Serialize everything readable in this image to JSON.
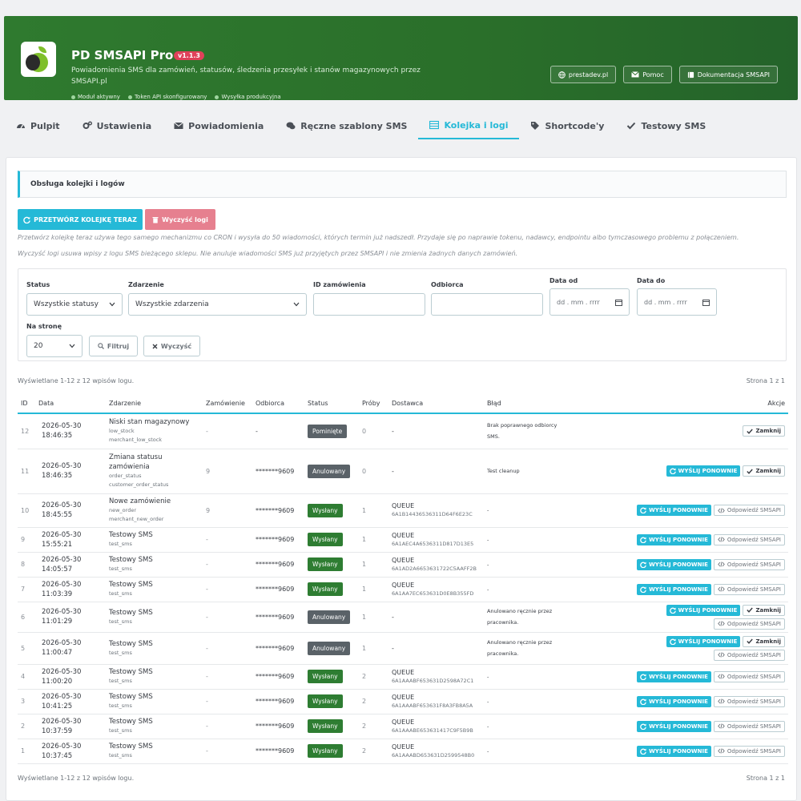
{
  "header": {
    "title": "PD SMSAPI Pro",
    "version": "v1.1.3",
    "description": "Powiadomienia SMS dla zamówień, statusów, śledzenia przesyłek i stanów magazynowych przez SMSAPI.pl",
    "status_pills": [
      "Moduł aktywny",
      "Token API skonfigurowany",
      "Wysyłka produkcyjna"
    ],
    "buttons": [
      "prestadev.pl",
      "Pomoc",
      "Dokumentacja SMSAPI"
    ]
  },
  "tabs": [
    "Pulpit",
    "Ustawienia",
    "Powiadomienia",
    "Ręczne szablony SMS",
    "Kolejka i logi",
    "Shortcode'y",
    "Testowy SMS"
  ],
  "active_tab": "Kolejka i logi",
  "section_title": "Obsługa kolejki i logów",
  "actions": {
    "process_queue": "PRZETWÓRZ KOLEJKĘ TERAZ",
    "clear_logs": "Wyczyść logi"
  },
  "help": [
    "Przetwórz kolejkę teraz używa tego samego mechanizmu co CRON i wysyła do 50 wiadomości, których termin już nadszedł. Przydaje się po naprawie tokenu, nadawcy, endpointu albo tymczasowego problemu z połączeniem.",
    "Wyczyść logi usuwa wpisy z logu SMS bieżącego sklepu. Nie anuluje wiadomości SMS już przyjętych przez SMSAPI i nie zmienia żadnych danych zamówień."
  ],
  "filters": {
    "status_label": "Status",
    "status_value": "Wszystkie statusy",
    "event_label": "Zdarzenie",
    "event_value": "Wszystkie zdarzenia",
    "order_id_label": "ID zamówienia",
    "recipient_label": "Odbiorca",
    "date_from_label": "Data od",
    "date_to_label": "Data do",
    "date_placeholder": "dd . mm . rrrr",
    "per_page_label": "Na stronę",
    "per_page_value": "20",
    "filter_btn": "Filtruj",
    "reset_btn": "Wyczyść"
  },
  "summary": "Wyświetlane 1-12 z 12 wpisów logu.",
  "page_info": "Strona 1 z 1",
  "columns": [
    "ID",
    "Data",
    "Zdarzenie",
    "Zamówienie",
    "Odbiorca",
    "Status",
    "Próby",
    "Dostawca",
    "Błąd",
    "Akcje"
  ],
  "action_labels": {
    "resend": "WYŚLIJ PONOWNIE",
    "close": "Zamknij",
    "reply": "Odpowiedź SMSAPI"
  },
  "rows": [
    {
      "id": "12",
      "date": "2026-05-30",
      "time": "18:46:35",
      "event": "Niski stan magazynowy",
      "codes": [
        "low_stock",
        "merchant_low_stock"
      ],
      "order": "-",
      "recipient": "-",
      "status": "Pominięte",
      "status_type": "skip",
      "tries": "0",
      "provider": "-",
      "provider_id": "",
      "error": "Brak poprawnego odbiorcy SMS.",
      "actions": [
        "close"
      ]
    },
    {
      "id": "11",
      "date": "2026-05-30",
      "time": "18:46:35",
      "event": "Zmiana statusu zamówienia",
      "codes": [
        "order_status",
        "customer_order_status"
      ],
      "order": "9",
      "recipient": "*******9609",
      "status": "Anulowany",
      "status_type": "cancel",
      "tries": "0",
      "provider": "-",
      "provider_id": "",
      "error": "Test cleanup",
      "actions": [
        "resend",
        "close"
      ]
    },
    {
      "id": "10",
      "date": "2026-05-30",
      "time": "18:45:55",
      "event": "Nowe zamówienie",
      "codes": [
        "new_order",
        "merchant_new_order"
      ],
      "order": "9",
      "recipient": "*******9609",
      "status": "Wysłany",
      "status_type": "sent",
      "tries": "1",
      "provider": "QUEUE",
      "provider_id": "6A1B14436536311D64F6E23C",
      "error": "-",
      "actions": [
        "resend",
        "reply"
      ]
    },
    {
      "id": "9",
      "date": "2026-05-30",
      "time": "15:55:21",
      "event": "Testowy SMS",
      "codes": [
        "test_sms"
      ],
      "order": "-",
      "recipient": "*******9609",
      "status": "Wysłany",
      "status_type": "sent",
      "tries": "1",
      "provider": "QUEUE",
      "provider_id": "6A1AEC4A6536311D817D13E5",
      "error": "-",
      "actions": [
        "resend",
        "reply"
      ]
    },
    {
      "id": "8",
      "date": "2026-05-30",
      "time": "14:05:57",
      "event": "Testowy SMS",
      "codes": [
        "test_sms"
      ],
      "order": "-",
      "recipient": "*******9609",
      "status": "Wysłany",
      "status_type": "sent",
      "tries": "1",
      "provider": "QUEUE",
      "provider_id": "6A1AD2A6653631722C5AAFF2B",
      "error": "-",
      "actions": [
        "resend",
        "reply"
      ]
    },
    {
      "id": "7",
      "date": "2026-05-30",
      "time": "11:03:39",
      "event": "Testowy SMS",
      "codes": [
        "test_sms"
      ],
      "order": "-",
      "recipient": "*******9609",
      "status": "Wysłany",
      "status_type": "sent",
      "tries": "1",
      "provider": "QUEUE",
      "provider_id": "6A1AA7EC653631D0E8B355FD",
      "error": "-",
      "actions": [
        "resend",
        "reply"
      ]
    },
    {
      "id": "6",
      "date": "2026-05-30",
      "time": "11:01:29",
      "event": "Testowy SMS",
      "codes": [
        "test_sms"
      ],
      "order": "-",
      "recipient": "*******9609",
      "status": "Anulowany",
      "status_type": "cancel",
      "tries": "1",
      "provider": "-",
      "provider_id": "",
      "error": "Anulowano ręcznie przez pracownika.",
      "actions": [
        "resend",
        "close",
        "reply"
      ]
    },
    {
      "id": "5",
      "date": "2026-05-30",
      "time": "11:00:47",
      "event": "Testowy SMS",
      "codes": [
        "test_sms"
      ],
      "order": "-",
      "recipient": "*******9609",
      "status": "Anulowany",
      "status_type": "cancel",
      "tries": "1",
      "provider": "-",
      "provider_id": "",
      "error": "Anulowano ręcznie przez pracownika.",
      "actions": [
        "resend",
        "close",
        "reply"
      ]
    },
    {
      "id": "4",
      "date": "2026-05-30",
      "time": "11:00:20",
      "event": "Testowy SMS",
      "codes": [
        "test_sms"
      ],
      "order": "-",
      "recipient": "*******9609",
      "status": "Wysłany",
      "status_type": "sent",
      "tries": "2",
      "provider": "QUEUE",
      "provider_id": "6A1AAABF653631D2598A72C1",
      "error": "-",
      "actions": [
        "resend",
        "reply"
      ]
    },
    {
      "id": "3",
      "date": "2026-05-30",
      "time": "10:41:25",
      "event": "Testowy SMS",
      "codes": [
        "test_sms"
      ],
      "order": "-",
      "recipient": "*******9609",
      "status": "Wysłany",
      "status_type": "sent",
      "tries": "2",
      "provider": "QUEUE",
      "provider_id": "6A1AAABF653631F8A3FB8A5A",
      "error": "-",
      "actions": [
        "resend",
        "reply"
      ]
    },
    {
      "id": "2",
      "date": "2026-05-30",
      "time": "10:37:59",
      "event": "Testowy SMS",
      "codes": [
        "test_sms"
      ],
      "order": "-",
      "recipient": "*******9609",
      "status": "Wysłany",
      "status_type": "sent",
      "tries": "2",
      "provider": "QUEUE",
      "provider_id": "6A1AAABE653631417C9F5B9B",
      "error": "-",
      "actions": [
        "resend",
        "reply"
      ]
    },
    {
      "id": "1",
      "date": "2026-05-30",
      "time": "10:37:45",
      "event": "Testowy SMS",
      "codes": [
        "test_sms"
      ],
      "order": "-",
      "recipient": "*******9609",
      "status": "Wysłany",
      "status_type": "sent",
      "tries": "2",
      "provider": "QUEUE",
      "provider_id": "6A1AAABD653631D2599548B0",
      "error": "-",
      "actions": [
        "resend",
        "reply"
      ]
    }
  ]
}
